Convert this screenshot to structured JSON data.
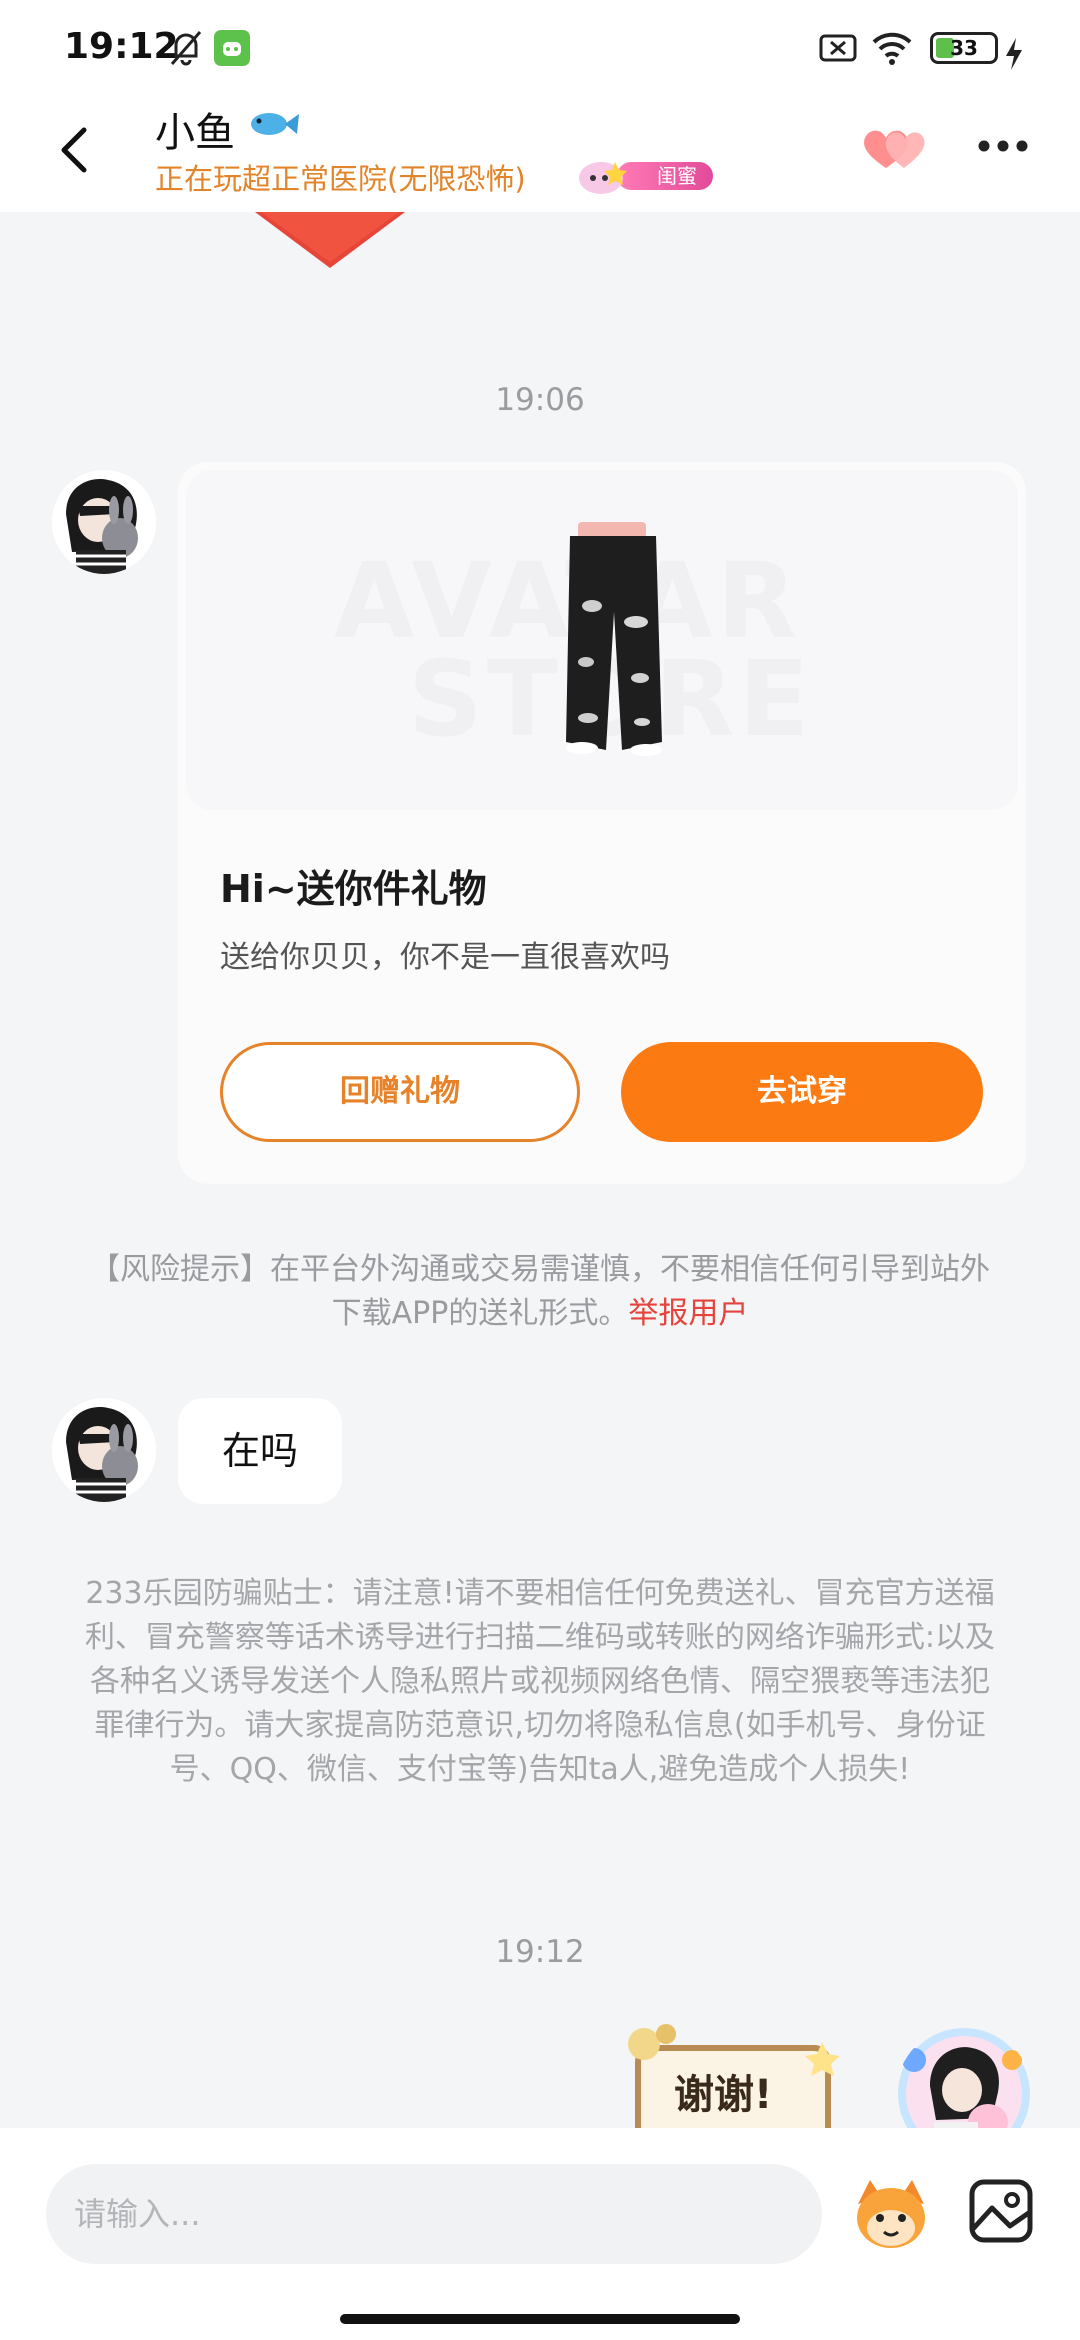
{
  "status_bar": {
    "time": "19:12",
    "battery": "33",
    "battery_level": 0.33,
    "icons": [
      "bell-off-icon",
      "android-app-icon",
      "sim-off-icon",
      "wifi-icon",
      "battery-icon",
      "charging-icon"
    ]
  },
  "header": {
    "contact_name": "小鱼",
    "activity": "正在玩超正常医院(无限恐怖)",
    "relationship_badge": "闺蜜",
    "icons": [
      "back-arrow-icon",
      "fish-emoji-icon",
      "hearts-icon",
      "more-icon"
    ]
  },
  "chat": {
    "timestamp_1": "19:06",
    "gift_card": {
      "watermark_line1": "AVATAR",
      "watermark_line2": "STORE",
      "title": "Hi~送你件礼物",
      "subtitle": "送给你贝贝，你不是一直很喜欢吗",
      "return_gift_label": "回赠礼物",
      "try_on_label": "去试穿"
    },
    "risk_notice": {
      "text": "【风险提示】在平台外沟通或交易需谨慎，不要相信任何引导到站外下载APP的送礼形式。",
      "report_link": "举报用户"
    },
    "message_1": "在吗",
    "fraud_notice": "233乐园防骗贴士：请注意!请不要相信任何免费送礼、冒充官方送福利、冒充警察等话术诱导进行扫描二维码或转账的网络诈骗形式:以及各种名义诱导发送个人隐私照片或视频网络色情、隔空猥亵等违法犯罪律行为。请大家提高防范意识,切勿将隐私信息(如手机号、身份证号、QQ、微信、支付宝等)告知ta人,避免造成个人损失!",
    "timestamp_2": "19:12",
    "sticker_text": "谢谢!"
  },
  "input_bar": {
    "placeholder": "请输入...",
    "icons": [
      "emoji-face-icon",
      "image-icon"
    ]
  },
  "colors": {
    "accent_orange": "#fb7a12",
    "activity_orange": "#e2842a",
    "report_red": "#e5433b",
    "background": "#f4f5f7"
  }
}
